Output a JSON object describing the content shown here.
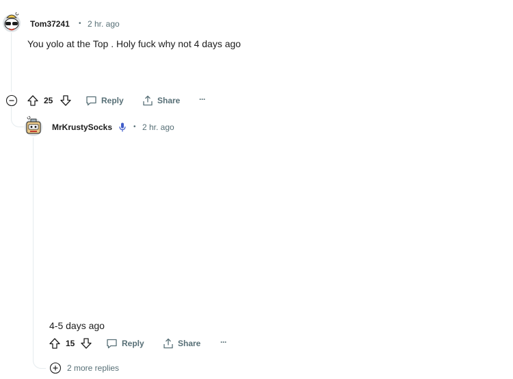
{
  "comment1": {
    "username": "Tom37241",
    "separator": "•",
    "time": "2 hr. ago",
    "body": "You yolo at the Top . Holy fuck why not 4 days ago",
    "votes": "25",
    "reply_label": "Reply",
    "share_label": "Share",
    "more_label": "···"
  },
  "comment2": {
    "username": "MrKrustySocks",
    "flair_icon": "microphone-icon",
    "separator": "•",
    "time": "2 hr. ago",
    "body": "4-5 days ago",
    "votes": "15",
    "reply_label": "Reply",
    "share_label": "Share",
    "more_label": "···"
  },
  "more_replies": {
    "label": "2 more replies"
  },
  "colors": {
    "text": "#1c1c1c",
    "meta": "#576f76",
    "thread": "#e5ebee",
    "mic": "#3f5cc9"
  }
}
